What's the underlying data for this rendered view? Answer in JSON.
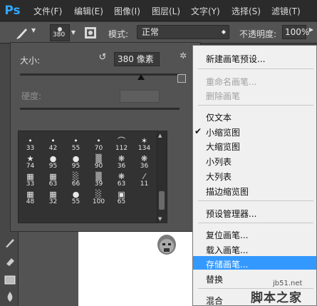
{
  "app": {
    "logo_text": "Ps"
  },
  "menubar": {
    "items": [
      {
        "label": "文件(F)"
      },
      {
        "label": "编辑(E)"
      },
      {
        "label": "图像(I)"
      },
      {
        "label": "图层(L)"
      },
      {
        "label": "文字(Y)"
      },
      {
        "label": "选择(S)"
      },
      {
        "label": "滤镜(T)"
      }
    ]
  },
  "options_bar": {
    "brush_size": "380",
    "mode_label": "模式:",
    "mode_value": "正常",
    "opacity_label": "不透明度:",
    "opacity_value": "100%"
  },
  "brush_panel": {
    "size_label": "大小:",
    "size_value": "380 像素",
    "size_slider_fraction": 0.76,
    "hardness_label": "硬度:",
    "presets": [
      {
        "n": "33",
        "glyph": "•"
      },
      {
        "n": "42",
        "glyph": "•"
      },
      {
        "n": "55",
        "glyph": "•"
      },
      {
        "n": "70",
        "glyph": "•"
      },
      {
        "n": "112",
        "glyph": "⌒"
      },
      {
        "n": "134",
        "glyph": "✶"
      },
      {
        "n": "74",
        "glyph": "★"
      },
      {
        "n": "95",
        "glyph": "●"
      },
      {
        "n": "95",
        "glyph": "●"
      },
      {
        "n": "90",
        "glyph": "▒"
      },
      {
        "n": "36",
        "glyph": "❋"
      },
      {
        "n": "36",
        "glyph": "❋"
      },
      {
        "n": "33",
        "glyph": "▦"
      },
      {
        "n": "63",
        "glyph": "▦"
      },
      {
        "n": "66",
        "glyph": "░"
      },
      {
        "n": "39",
        "glyph": "▒"
      },
      {
        "n": "63",
        "glyph": "❋"
      },
      {
        "n": "11",
        "glyph": "⁄"
      },
      {
        "n": "48",
        "glyph": "▦"
      },
      {
        "n": "32",
        "glyph": "▦"
      },
      {
        "n": "55",
        "glyph": "●"
      },
      {
        "n": "100",
        "glyph": "░"
      },
      {
        "n": "65",
        "glyph": "▣"
      }
    ]
  },
  "flyout_menu": {
    "items": [
      {
        "label": "新建画笔预设...",
        "disabled": false
      },
      {
        "label": "重命名画笔...",
        "disabled": true
      },
      {
        "label": "删除画笔",
        "disabled": true
      },
      {
        "label": "仅文本",
        "disabled": false
      },
      {
        "label": "小缩览图",
        "disabled": false,
        "checked": true
      },
      {
        "label": "大缩览图",
        "disabled": false
      },
      {
        "label": "小列表",
        "disabled": false
      },
      {
        "label": "大列表",
        "disabled": false
      },
      {
        "label": "描边缩览图",
        "disabled": false
      },
      {
        "label": "预设管理器...",
        "disabled": false
      },
      {
        "label": "复位画笔...",
        "disabled": false
      },
      {
        "label": "载入画笔...",
        "disabled": false
      },
      {
        "label": "存储画笔...",
        "disabled": false,
        "highlighted": true
      },
      {
        "label": "替换",
        "disabled": false
      },
      {
        "label": "混合",
        "disabled": false
      }
    ],
    "check_glyph": "✔"
  },
  "watermark": {
    "url": "jb51.net",
    "text": "脚本之家"
  },
  "colors": {
    "menubar_bg": "#2b2b2b",
    "panel_bg": "#535353",
    "highlight": "#3399ff",
    "logo": "#31a8ff"
  }
}
